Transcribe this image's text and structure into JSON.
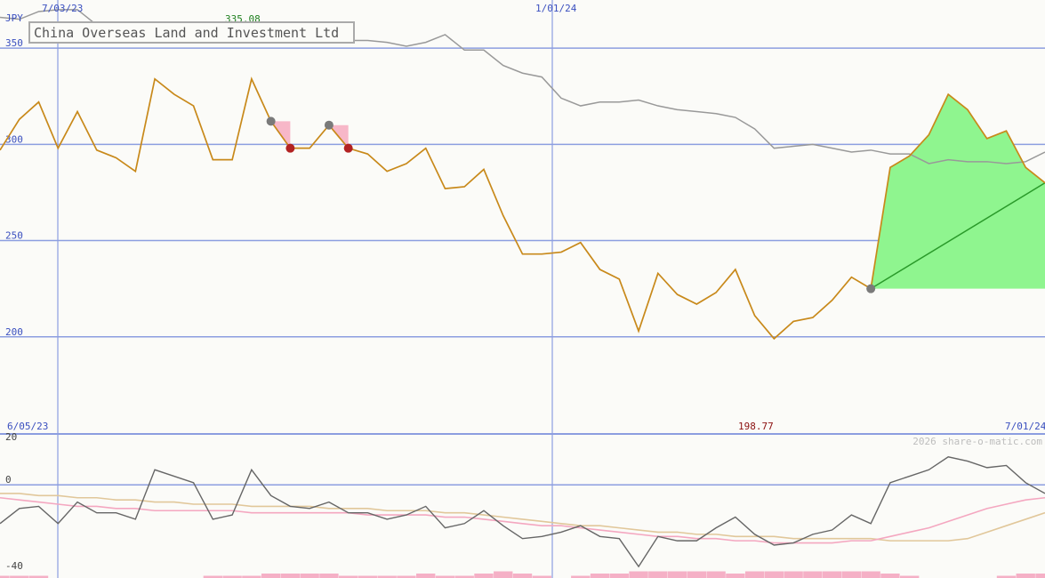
{
  "chart_data": {
    "type": "line",
    "title": "China Overseas Land and Investment Ltd",
    "currency": "JPY",
    "watermark": "2026 share-o-matic.com",
    "max_label": "335.08",
    "min_label": "198.77",
    "date_labels": {
      "top": [
        "7/03/23",
        "1/01/24"
      ],
      "bottom_left": "6/05/23",
      "bottom_right": "7/01/24"
    },
    "price_panel": {
      "ylim": [
        150,
        375
      ],
      "yticks": [
        350,
        300,
        250,
        200
      ],
      "price": [
        297,
        313,
        322,
        298,
        317,
        297,
        293,
        286,
        334,
        326,
        320,
        292,
        292,
        334,
        312,
        298,
        298,
        310,
        298,
        295,
        286,
        290,
        298,
        277,
        278,
        287,
        263,
        243,
        243,
        244,
        249,
        235,
        230,
        203,
        233,
        222,
        217,
        223,
        235,
        211,
        199,
        208,
        210,
        219,
        231,
        225,
        288,
        294,
        305,
        326,
        318,
        303,
        307,
        288,
        280
      ],
      "comparison": [
        366,
        365,
        369,
        370,
        370,
        362,
        353,
        355,
        356,
        356,
        360,
        360,
        359,
        358,
        358,
        359,
        359,
        357,
        354,
        354,
        353,
        351,
        353,
        357,
        349,
        349,
        341,
        337,
        335,
        324,
        320,
        322,
        322,
        323,
        320,
        318,
        317,
        316,
        314,
        308,
        298,
        299,
        300,
        298,
        296,
        297,
        295,
        295,
        290,
        292,
        291,
        291,
        290,
        291,
        296
      ],
      "sell_signals": [
        {
          "from": 14,
          "to": 15
        },
        {
          "from": 17,
          "to": 18
        }
      ],
      "trend_start": 45,
      "trend_end": 54
    },
    "indicator_panel": {
      "ylim": [
        -40,
        22
      ],
      "yticks": [
        20,
        0,
        -40
      ],
      "line": [
        -18,
        -11,
        -10,
        -18,
        -8,
        -13,
        -13,
        -16,
        7,
        4,
        1,
        -16,
        -14,
        7,
        -5,
        -10,
        -11,
        -8,
        -13,
        -13,
        -16,
        -14,
        -10,
        -20,
        -18,
        -12,
        -19,
        -25,
        -24,
        -22,
        -19,
        -24,
        -25,
        -38,
        -24,
        -26,
        -26,
        -20,
        -15,
        -23,
        -28,
        -27,
        -23,
        -21,
        -14,
        -18,
        1,
        4,
        7,
        13,
        11,
        8,
        9,
        1,
        -4
      ],
      "ma_fast": [
        -6,
        -7,
        -8,
        -9,
        -10,
        -10,
        -11,
        -11,
        -12,
        -12,
        -12,
        -12,
        -12,
        -13,
        -13,
        -13,
        -13,
        -13,
        -13,
        -14,
        -14,
        -14,
        -14,
        -15,
        -15,
        -16,
        -17,
        -18,
        -19,
        -19,
        -20,
        -21,
        -22,
        -23,
        -24,
        -24,
        -25,
        -25,
        -26,
        -26,
        -27,
        -27,
        -27,
        -27,
        -26,
        -26,
        -24,
        -22,
        -20,
        -17,
        -14,
        -11,
        -9,
        -7,
        -6
      ],
      "ma_slow": [
        -4,
        -4,
        -5,
        -5,
        -6,
        -6,
        -7,
        -7,
        -8,
        -8,
        -9,
        -9,
        -9,
        -10,
        -10,
        -10,
        -10,
        -11,
        -11,
        -11,
        -12,
        -12,
        -12,
        -13,
        -13,
        -14,
        -15,
        -16,
        -17,
        -18,
        -19,
        -19,
        -20,
        -21,
        -22,
        -22,
        -23,
        -23,
        -24,
        -24,
        -24,
        -25,
        -25,
        -25,
        -25,
        -25,
        -26,
        -26,
        -26,
        -26,
        -25,
        -22,
        -19,
        -16,
        -13
      ],
      "volume": [
        1,
        1,
        1,
        0,
        0,
        0,
        0,
        0,
        0,
        0,
        0,
        1,
        1,
        1,
        2,
        2,
        2,
        2,
        1,
        1,
        1,
        1,
        2,
        1,
        1,
        2,
        3,
        2,
        1,
        0,
        1,
        2,
        2,
        3,
        3,
        3,
        3,
        3,
        2,
        3,
        3,
        3,
        3,
        3,
        3,
        3,
        2,
        1,
        0,
        0,
        0,
        0,
        1,
        2,
        2
      ]
    },
    "colors": {
      "price": "#c8891a",
      "comparison": "#999999",
      "grid": "#8c9ee0",
      "trend_fill": "#8ff58f",
      "trend_line": "#2a9a2a",
      "sell_marker": "#b22222",
      "signal_marker": "#7a7a7a",
      "sell_triangle": "#f7b7c8",
      "ma_fast": "#f4a7c0",
      "ma_slow": "#e1c79a",
      "indicator_line": "#666666",
      "volume": "#f5b0c6",
      "axis_label": "#3a4fbf",
      "max_label": "#208020",
      "min_label": "#8b1010"
    }
  }
}
